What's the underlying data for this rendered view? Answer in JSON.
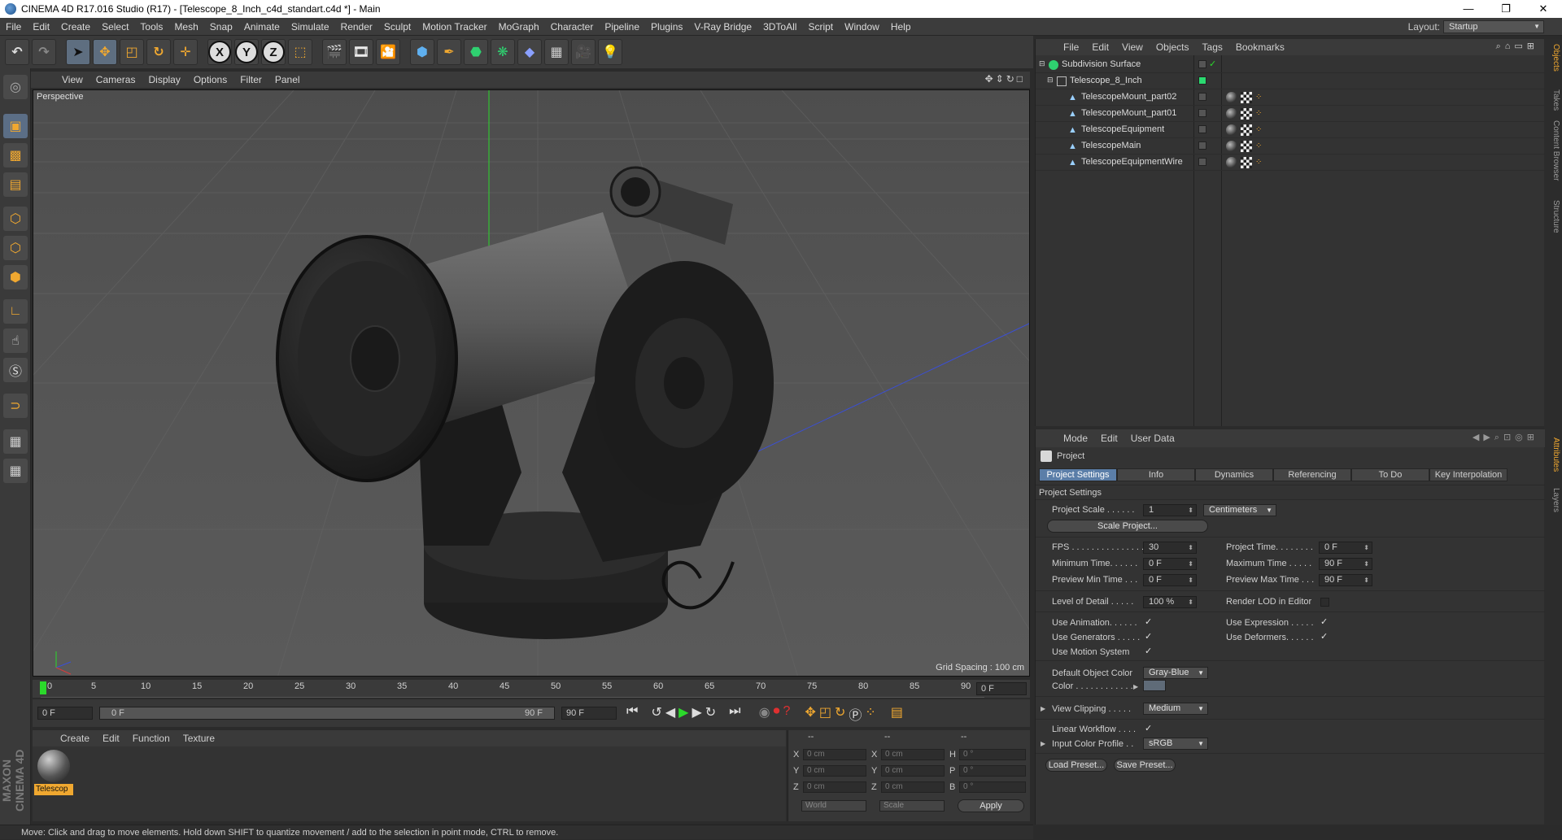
{
  "window": {
    "title": "CINEMA 4D R17.016 Studio (R17) - [Telescope_8_Inch_c4d_standart.c4d *] - Main",
    "minimize": "—",
    "maximize": "❐",
    "close": "✕"
  },
  "menubar": {
    "items": [
      "File",
      "Edit",
      "Create",
      "Select",
      "Tools",
      "Mesh",
      "Snap",
      "Animate",
      "Simulate",
      "Render",
      "Sculpt",
      "Motion Tracker",
      "MoGraph",
      "Character",
      "Pipeline",
      "Plugins",
      "V-Ray Bridge",
      "3DToAll",
      "Script",
      "Window",
      "Help"
    ],
    "layout_label": "Layout:",
    "layout_value": "Startup"
  },
  "toolbar": {
    "undo": "↶",
    "redo": "↷",
    "axis_x": "X",
    "axis_y": "Y",
    "axis_z": "Z",
    "icons": [
      "select-arrow",
      "move",
      "scale",
      "rotate",
      "move-plus",
      "coord-system",
      "render-view",
      "render-picture",
      "render-settings",
      "cube",
      "pen",
      "subdivision",
      "array",
      "deformer",
      "floor",
      "camera",
      "light"
    ]
  },
  "viewport": {
    "menu": [
      "View",
      "Cameras",
      "Display",
      "Options",
      "Filter",
      "Panel"
    ],
    "label": "Perspective",
    "grid_spacing": "Grid Spacing : 100 cm"
  },
  "timeline": {
    "ticks": [
      "0",
      "5",
      "10",
      "15",
      "20",
      "25",
      "30",
      "35",
      "40",
      "45",
      "50",
      "55",
      "60",
      "65",
      "70",
      "75",
      "80",
      "85",
      "90"
    ],
    "current_frame": "0 F",
    "start_field": "0 F",
    "range_start": "0 F",
    "range_end": "90 F",
    "end_field": "90 F"
  },
  "material_manager": {
    "menu": [
      "Create",
      "Edit",
      "Function",
      "Texture"
    ],
    "material_name": "Telescop"
  },
  "coordinates": {
    "header": [
      "--",
      "--",
      "--"
    ],
    "rows": [
      {
        "a": "X",
        "av": "0 cm",
        "b": "X",
        "bv": "0 cm",
        "c": "H",
        "cv": "0 °"
      },
      {
        "a": "Y",
        "av": "0 cm",
        "b": "Y",
        "bv": "0 cm",
        "c": "P",
        "cv": "0 °"
      },
      {
        "a": "Z",
        "av": "0 cm",
        "b": "Z",
        "bv": "0 cm",
        "c": "B",
        "cv": "0 °"
      }
    ],
    "mode1": "World",
    "mode2": "Scale",
    "apply": "Apply"
  },
  "status": "Move: Click and drag to move elements. Hold down SHIFT to quantize movement / add to the selection in point mode, CTRL to remove.",
  "maxon_logo": "MAXON CINEMA 4D",
  "object_manager": {
    "menu": [
      "File",
      "Edit",
      "View",
      "Objects",
      "Tags",
      "Bookmarks"
    ],
    "objects": [
      {
        "name": "Subdivision Surface",
        "indent": 0,
        "icon": "subdivision-icon"
      },
      {
        "name": "Telescope_8_Inch",
        "indent": 1,
        "icon": "null-object-icon"
      },
      {
        "name": "TelescopeMount_part02",
        "indent": 2,
        "icon": "polygon-object-icon"
      },
      {
        "name": "TelescopeMount_part01",
        "indent": 2,
        "icon": "polygon-object-icon"
      },
      {
        "name": "TelescopeEquipment",
        "indent": 2,
        "icon": "polygon-object-icon"
      },
      {
        "name": "TelescopeMain",
        "indent": 2,
        "icon": "polygon-object-icon"
      },
      {
        "name": "TelescopeEquipmentWire",
        "indent": 2,
        "icon": "polygon-object-icon"
      }
    ]
  },
  "right_tabs": [
    "Objects",
    "Takes",
    "Content Browser",
    "Structure",
    "Attributes",
    "Layers"
  ],
  "attribute_manager": {
    "menu": [
      "Mode",
      "Edit",
      "User Data"
    ],
    "title": "Project",
    "tabs": [
      "Project Settings",
      "Info",
      "Dynamics",
      "Referencing",
      "To Do",
      "Key Interpolation"
    ],
    "section": "Project Settings",
    "project_scale_label": "Project Scale . . . . . .",
    "project_scale_value": "1",
    "project_scale_unit": "Centimeters",
    "scale_project_btn": "Scale Project...",
    "fps_label": "FPS . . . . . . . . . . . . . . .",
    "fps_value": "30",
    "project_time_label": "Project Time. . . . . . . .",
    "project_time_value": "0 F",
    "min_time_label": "Minimum Time. . . . . .",
    "min_time_value": "0 F",
    "max_time_label": "Maximum Time . . . . .",
    "max_time_value": "90 F",
    "prev_min_label": "Preview Min Time . . .",
    "prev_min_value": "0 F",
    "prev_max_label": "Preview Max Time . . .",
    "prev_max_value": "90 F",
    "lod_label": "Level of Detail . . . . .",
    "lod_value": "100 %",
    "render_lod_label": "Render LOD in Editor",
    "use_anim_label": "Use Animation. . . . . .",
    "use_expr_label": "Use Expression . . . . .",
    "use_gen_label": "Use Generators . . . . .",
    "use_def_label": "Use Deformers. . . . . .",
    "use_motion_label": "Use Motion System",
    "default_color_label": "Default Object Color",
    "default_color_value": "Gray-Blue",
    "color_label": "Color . . . . . . . . . . . .",
    "view_clipping_label": "View Clipping . . . . .",
    "view_clipping_value": "Medium",
    "linear_workflow_label": "Linear Workflow . . . .",
    "input_profile_label": "Input Color Profile . .",
    "input_profile_value": "sRGB",
    "load_preset": "Load Preset...",
    "save_preset": "Save Preset...",
    "check": "✓"
  },
  "colors": {
    "accent": "#f0a830",
    "selected_tab": "#5b7ea8",
    "viewport_bg": "#545454",
    "green_axis": "#2bd92b",
    "blue_axis": "#3a4fd8"
  }
}
